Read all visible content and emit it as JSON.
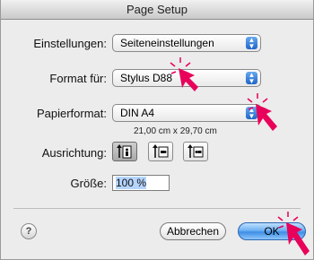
{
  "window": {
    "title": "Page Setup"
  },
  "settings": {
    "label": "Einstellungen:",
    "value": "Seiteneinstellungen"
  },
  "format_for": {
    "label": "Format für:",
    "value": "Stylus D88"
  },
  "paper_format": {
    "label": "Papierformat:",
    "value": "DIN A4",
    "size_text": "21,00 cm x 29,70 cm"
  },
  "orientation": {
    "label": "Ausrichtung:",
    "options": [
      "portrait",
      "landscape-left",
      "landscape-right"
    ],
    "selected": "portrait"
  },
  "scale": {
    "label": "Größe:",
    "value": "100 %"
  },
  "buttons": {
    "help": "?",
    "cancel": "Abbrechen",
    "ok": "OK"
  },
  "colors": {
    "accent": "#e8005a",
    "default_button": "#6fb1f3",
    "popup_arrow": "#1f66c8"
  },
  "icons": [
    "question-mark-icon",
    "popup-arrows-icon",
    "portrait-icon",
    "landscape-left-icon",
    "landscape-right-icon",
    "click-pointer-icon"
  ]
}
